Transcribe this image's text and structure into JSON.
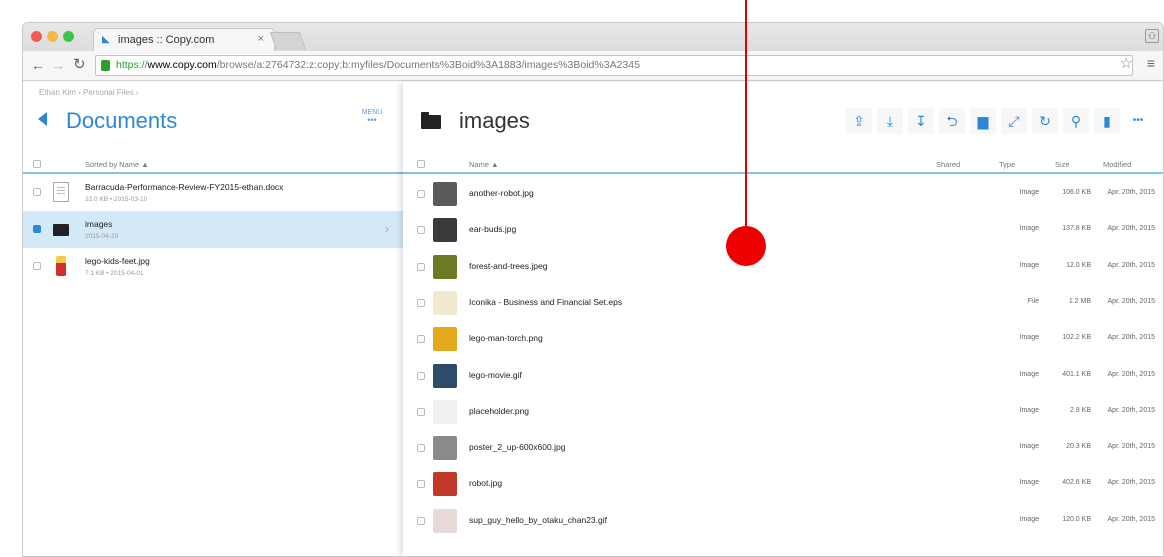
{
  "browser": {
    "tab_title": "images :: Copy.com",
    "tab_close": "×",
    "url_scheme": "https://",
    "url_host": "www.copy.com",
    "url_path": "/browse/a:2764732:z:copy:b:myfiles/Documents%3Boid%3A1883/images%3Boid%3A2345"
  },
  "left": {
    "breadcrumb": "Ethan Kim  ›  Personal Files  ›",
    "title": "Documents",
    "menu_label": "MENU",
    "menu_dots": "•••",
    "sort_label": "Sorted by Name ▲",
    "rows": [
      {
        "name": "Barracuda-Performance-Review-FY2015-ethan.docx",
        "meta": "22.0 KB • 2015-03-10",
        "kind": "doc",
        "selected": false
      },
      {
        "name": "images",
        "meta": "2015-04-20",
        "kind": "folder",
        "selected": true
      },
      {
        "name": "lego-kids-feet.jpg",
        "meta": "7.1 KB • 2015-04-01",
        "kind": "lego",
        "selected": false
      }
    ]
  },
  "right": {
    "title": "images",
    "headers": {
      "name": "Name ▲",
      "shared": "Shared",
      "type": "Type",
      "size": "Size",
      "modified": "Modified"
    },
    "actions": [
      {
        "icon": "share-icon",
        "glyph": "⇪"
      },
      {
        "icon": "download-icon",
        "glyph": "⤓"
      },
      {
        "icon": "download-alt-icon",
        "glyph": "↧"
      },
      {
        "icon": "move-icon",
        "glyph": "⮌"
      },
      {
        "icon": "folder-add-icon",
        "glyph": "▆"
      },
      {
        "icon": "link-icon",
        "glyph": "⤢"
      },
      {
        "icon": "refresh-icon",
        "glyph": "↻"
      },
      {
        "icon": "search-icon",
        "glyph": "⚲"
      },
      {
        "icon": "trash-icon",
        "glyph": "▮"
      },
      {
        "icon": "more-icon",
        "glyph": "•••"
      }
    ],
    "files": [
      {
        "name": "another-robot.jpg",
        "type": "Image",
        "size": "106.0 KB",
        "modified": "Apr. 20th, 2015",
        "thumb": "#5a5a5a"
      },
      {
        "name": "ear-buds.jpg",
        "type": "Image",
        "size": "137.8 KB",
        "modified": "Apr. 20th, 2015",
        "thumb": "#3a3a3a"
      },
      {
        "name": "forest-and-trees.jpeg",
        "type": "Image",
        "size": "12.0 KB",
        "modified": "Apr. 20th, 2015",
        "thumb": "#6b7a24"
      },
      {
        "name": "Iconika - Business and Financial Set.eps",
        "type": "File",
        "size": "1.2 MB",
        "modified": "Apr. 20th, 2015",
        "thumb": "#f1ead0"
      },
      {
        "name": "lego-man-torch.png",
        "type": "Image",
        "size": "102.2 KB",
        "modified": "Apr. 20th, 2015",
        "thumb": "#e2a91c"
      },
      {
        "name": "lego-movie.gif",
        "type": "Image",
        "size": "401.1 KB",
        "modified": "Apr. 20th, 2015",
        "thumb": "#2e4b6a"
      },
      {
        "name": "placeholder.png",
        "type": "Image",
        "size": "2.8 KB",
        "modified": "Apr. 20th, 2015",
        "thumb": "#f0f0f0"
      },
      {
        "name": "poster_2_up-600x600.jpg",
        "type": "Image",
        "size": "20.3 KB",
        "modified": "Apr. 20th, 2015",
        "thumb": "#8a8a8a"
      },
      {
        "name": "robot.jpg",
        "type": "Image",
        "size": "402.6 KB",
        "modified": "Apr. 20th, 2015",
        "thumb": "#c0392b"
      },
      {
        "name": "sup_guy_hello_by_otaku_chan23.gif",
        "type": "Image",
        "size": "120.0 KB",
        "modified": "Apr. 20th, 2015",
        "thumb": "#e8d9d9"
      }
    ]
  },
  "colors": {
    "accent": "#2b88d9",
    "annotation": "#ee0000",
    "selected_row": "#d4e9f7"
  }
}
